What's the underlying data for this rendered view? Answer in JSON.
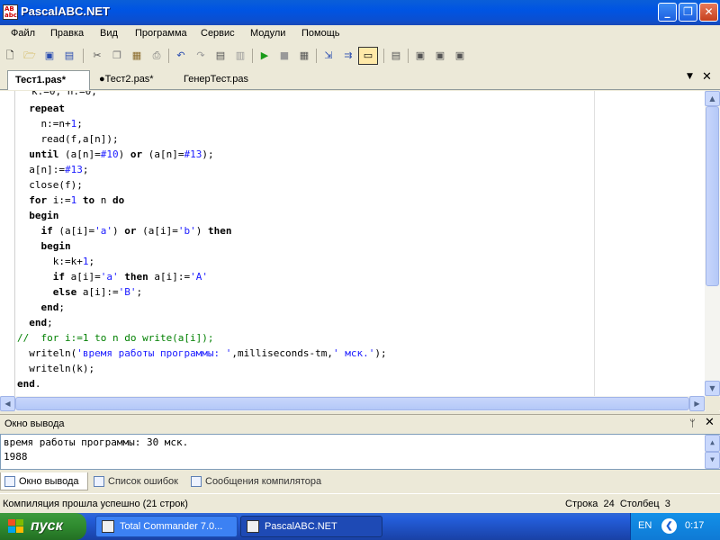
{
  "window": {
    "title": "PascalABC.NET",
    "app_icon": "AB abc"
  },
  "colors": {
    "keyword": "#000000",
    "string": "#1a1aff",
    "comment": "#008000",
    "titlebar": "#0054e3"
  },
  "menu": [
    {
      "label": "Файл"
    },
    {
      "label": "Правка"
    },
    {
      "label": "Вид"
    },
    {
      "label": "Программа"
    },
    {
      "label": "Сервис"
    },
    {
      "label": "Модули"
    },
    {
      "label": "Помощь"
    }
  ],
  "toolbar_icons": [
    "new-icon",
    "open-icon",
    "save-icon",
    "save-all-icon",
    "cut-icon",
    "copy-icon",
    "paste-icon",
    "print-icon",
    "undo-icon",
    "redo-icon",
    "debug-icon",
    "stop-debug-icon",
    "run-icon",
    "stop-icon",
    "compile-icon",
    "step-into-icon",
    "step-over-icon",
    "output-window-icon",
    "property-icon",
    "module-icon",
    "project-icon",
    "settings-icon"
  ],
  "tabs": [
    {
      "label": "Тест1.pas*"
    },
    {
      "label": "●Тест2.pas*"
    },
    {
      "label": "ГенерТест.pas"
    }
  ],
  "editor": {
    "cut_line": "k:=0; n:=0;",
    "lines": [
      [
        {
          "t": "  "
        },
        {
          "t": "repeat",
          "c": "kw"
        }
      ],
      [
        {
          "t": "    n:=n+"
        },
        {
          "t": "1",
          "c": "num"
        },
        {
          "t": ";"
        }
      ],
      [
        {
          "t": "    read(f,a[n]);"
        }
      ],
      [
        {
          "t": "  "
        },
        {
          "t": "until",
          "c": "kw"
        },
        {
          "t": " (a[n]="
        },
        {
          "t": "#10",
          "c": "num"
        },
        {
          "t": ") "
        },
        {
          "t": "or",
          "c": "kw"
        },
        {
          "t": " (a[n]="
        },
        {
          "t": "#13",
          "c": "num"
        },
        {
          "t": ");"
        }
      ],
      [
        {
          "t": "  a[n]:="
        },
        {
          "t": "#13",
          "c": "num"
        },
        {
          "t": ";"
        }
      ],
      [
        {
          "t": "  close(f);"
        }
      ],
      [
        {
          "t": "  "
        },
        {
          "t": "for",
          "c": "kw"
        },
        {
          "t": " i:="
        },
        {
          "t": "1",
          "c": "num"
        },
        {
          "t": " "
        },
        {
          "t": "to",
          "c": "kw"
        },
        {
          "t": " n "
        },
        {
          "t": "do",
          "c": "kw"
        }
      ],
      [
        {
          "t": "  "
        },
        {
          "t": "begin",
          "c": "kw"
        }
      ],
      [
        {
          "t": "    "
        },
        {
          "t": "if",
          "c": "kw"
        },
        {
          "t": " (a[i]="
        },
        {
          "t": "'a'",
          "c": "str"
        },
        {
          "t": ") "
        },
        {
          "t": "or",
          "c": "kw"
        },
        {
          "t": " (a[i]="
        },
        {
          "t": "'b'",
          "c": "str"
        },
        {
          "t": ") "
        },
        {
          "t": "then",
          "c": "kw"
        }
      ],
      [
        {
          "t": "    "
        },
        {
          "t": "begin",
          "c": "kw"
        }
      ],
      [
        {
          "t": "      k:=k+"
        },
        {
          "t": "1",
          "c": "num"
        },
        {
          "t": ";"
        }
      ],
      [
        {
          "t": "      "
        },
        {
          "t": "if",
          "c": "kw"
        },
        {
          "t": " a[i]="
        },
        {
          "t": "'a'",
          "c": "str"
        },
        {
          "t": " "
        },
        {
          "t": "then",
          "c": "kw"
        },
        {
          "t": " a[i]:="
        },
        {
          "t": "'A'",
          "c": "str"
        }
      ],
      [
        {
          "t": "      "
        },
        {
          "t": "else",
          "c": "kw"
        },
        {
          "t": " a[i]:="
        },
        {
          "t": "'B'",
          "c": "str"
        },
        {
          "t": ";"
        }
      ],
      [
        {
          "t": "    "
        },
        {
          "t": "end",
          "c": "kw"
        },
        {
          "t": ";"
        }
      ],
      [
        {
          "t": "  "
        },
        {
          "t": "end",
          "c": "kw"
        },
        {
          "t": ";"
        }
      ],
      [
        {
          "t": "//  for i:=1 to n do write(a[i]);",
          "c": "cmt"
        }
      ],
      [
        {
          "t": "  writeln("
        },
        {
          "t": "'время работы программы: '",
          "c": "str"
        },
        {
          "t": ",milliseconds-tm,"
        },
        {
          "t": "' мск.'",
          "c": "str"
        },
        {
          "t": ");"
        }
      ],
      [
        {
          "t": "  writeln(k);"
        }
      ],
      [
        {
          "t": "end",
          "c": "kw"
        },
        {
          "t": "."
        }
      ]
    ]
  },
  "output": {
    "title": "Окно вывода",
    "pin_glyph": "ᛘ",
    "close_glyph": "✕",
    "lines": [
      "время работы программы: 30 мск.",
      "1988"
    ]
  },
  "bottom_tabs": [
    {
      "label": "Окно вывода"
    },
    {
      "label": "Список ошибок"
    },
    {
      "label": "Сообщения компилятора"
    }
  ],
  "status": {
    "message": "Компиляция прошла успешно (21 строк)",
    "position": "Строка  24  Столбец  3"
  },
  "taskbar": {
    "start_label": "пуск",
    "tasks": [
      {
        "label": "Total Commander 7.0..."
      },
      {
        "label": "PascalABC.NET"
      }
    ],
    "language": "EN",
    "clock": "0:17"
  }
}
